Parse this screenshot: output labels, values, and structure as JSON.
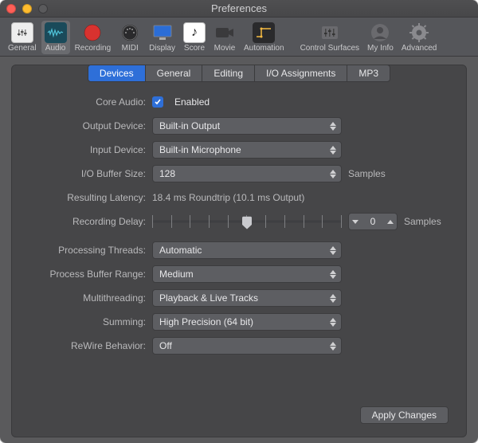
{
  "window": {
    "title": "Preferences"
  },
  "toolbar": {
    "items": [
      {
        "id": "general",
        "label": "General"
      },
      {
        "id": "audio",
        "label": "Audio"
      },
      {
        "id": "recording",
        "label": "Recording"
      },
      {
        "id": "midi",
        "label": "MIDI"
      },
      {
        "id": "display",
        "label": "Display"
      },
      {
        "id": "score",
        "label": "Score"
      },
      {
        "id": "movie",
        "label": "Movie"
      },
      {
        "id": "automation",
        "label": "Automation"
      },
      {
        "id": "control-surfaces",
        "label": "Control Surfaces"
      },
      {
        "id": "my-info",
        "label": "My Info"
      },
      {
        "id": "advanced",
        "label": "Advanced"
      }
    ],
    "active": "audio"
  },
  "tabs": {
    "items": [
      "Devices",
      "General",
      "Editing",
      "I/O Assignments",
      "MP3"
    ],
    "active": "Devices"
  },
  "labels": {
    "core_audio": "Core Audio:",
    "output_device": "Output Device:",
    "input_device": "Input Device:",
    "io_buffer": "I/O Buffer Size:",
    "resulting_latency": "Resulting Latency:",
    "recording_delay": "Recording Delay:",
    "processing_threads": "Processing Threads:",
    "process_buffer_range": "Process Buffer Range:",
    "multithreading": "Multithreading:",
    "summing": "Summing:",
    "rewire": "ReWire Behavior:"
  },
  "values": {
    "core_audio_enabled_label": "Enabled",
    "output_device": "Built-in Output",
    "input_device": "Built-in Microphone",
    "io_buffer": "128",
    "io_buffer_unit": "Samples",
    "resulting_latency": "18.4 ms Roundtrip (10.1 ms Output)",
    "recording_delay": "0",
    "recording_delay_unit": "Samples",
    "processing_threads": "Automatic",
    "process_buffer_range": "Medium",
    "multithreading": "Playback & Live Tracks",
    "summing": "High Precision (64 bit)",
    "rewire": "Off"
  },
  "buttons": {
    "apply": "Apply Changes"
  }
}
